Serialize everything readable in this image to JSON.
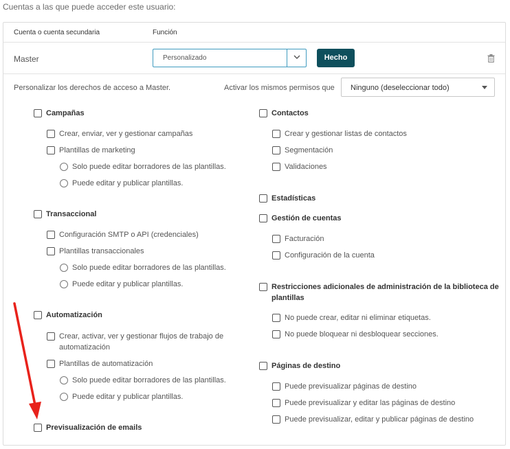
{
  "intro_text": "Cuentas a las que puede acceder este usuario:",
  "table": {
    "col_account": "Cuenta o cuenta secundaria",
    "col_function": "Función",
    "row_account": "Master",
    "function_value": "Personalizado",
    "done_label": "Hecho"
  },
  "customize_text": "Personalizar los derechos de acceso a Master.",
  "same_perms_label": "Activar los mismos permisos que",
  "same_perms_value": "Ninguno (deseleccionar todo)",
  "left": {
    "campaigns": {
      "title": "Campañas",
      "create": "Crear, enviar, ver y gestionar campañas",
      "templates": "Plantillas de marketing",
      "only_drafts": "Solo puede editar borradores de las plantillas.",
      "edit_publish": "Puede editar y publicar plantillas."
    },
    "transactional": {
      "title": "Transaccional",
      "smtp": "Configuración SMTP o API (credenciales)",
      "templates": "Plantillas transaccionales",
      "only_drafts": "Solo puede editar borradores de las plantillas.",
      "edit_publish": "Puede editar y publicar plantillas."
    },
    "automation": {
      "title": "Automatización",
      "create_line1": "Crear, activar, ver y gestionar flujos de trabajo de",
      "create_line2": "automatización",
      "templates": "Plantillas de automatización",
      "only_drafts": "Solo puede editar borradores de las plantillas.",
      "edit_publish": "Puede editar y publicar plantillas."
    },
    "preview_emails": "Previsualización de emails"
  },
  "right": {
    "contacts": {
      "title": "Contactos",
      "lists": "Crear y gestionar listas de contactos",
      "segmentation": "Segmentación",
      "validations": "Validaciones"
    },
    "statistics": "Estadísticas",
    "accounts": {
      "title": "Gestión de cuentas",
      "billing": "Facturación",
      "config": "Configuración de la cuenta"
    },
    "library": {
      "title_line1": "Restricciones adicionales de administración de la biblioteca de",
      "title_line2": "plantillas",
      "tags": "No puede crear, editar ni eliminar etiquetas.",
      "sections": "No puede bloquear ni desbloquear secciones."
    },
    "landing": {
      "title": "Páginas de destino",
      "preview": "Puede previsualizar páginas de destino",
      "preview_edit": "Puede previsualizar y editar las páginas de destino",
      "preview_edit_publish": "Puede previsualizar, editar y publicar páginas de destino"
    }
  },
  "colors": {
    "primary_button": "#0e4f5c",
    "focus_border": "#3f9bbf",
    "annotation_arrow": "#e8221b"
  }
}
